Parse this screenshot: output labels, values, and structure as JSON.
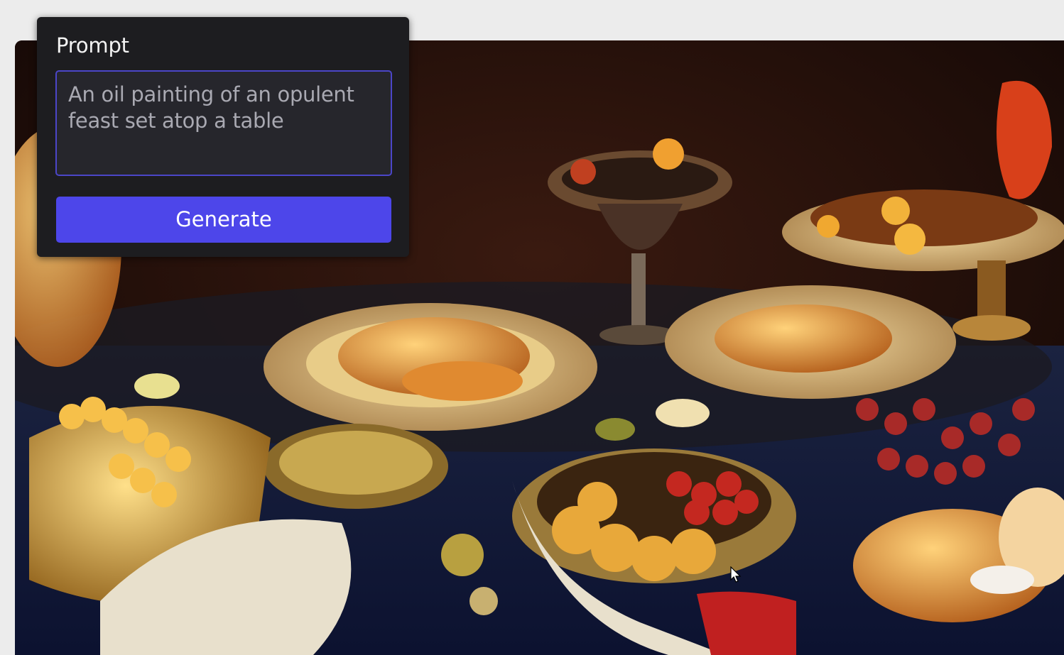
{
  "prompt_panel": {
    "label": "Prompt",
    "textarea_value": "An oil painting of an opulent feast set atop a table",
    "generate_label": "Generate"
  },
  "canvas": {
    "image_description_icon": "generated-painting-image"
  },
  "colors": {
    "accent": "#4d46ea",
    "panel_bg": "#1d1d20",
    "textarea_border": "#4b46c8",
    "page_bg": "#ececec"
  },
  "icons": {
    "cursor": "mouse-pointer-icon"
  }
}
